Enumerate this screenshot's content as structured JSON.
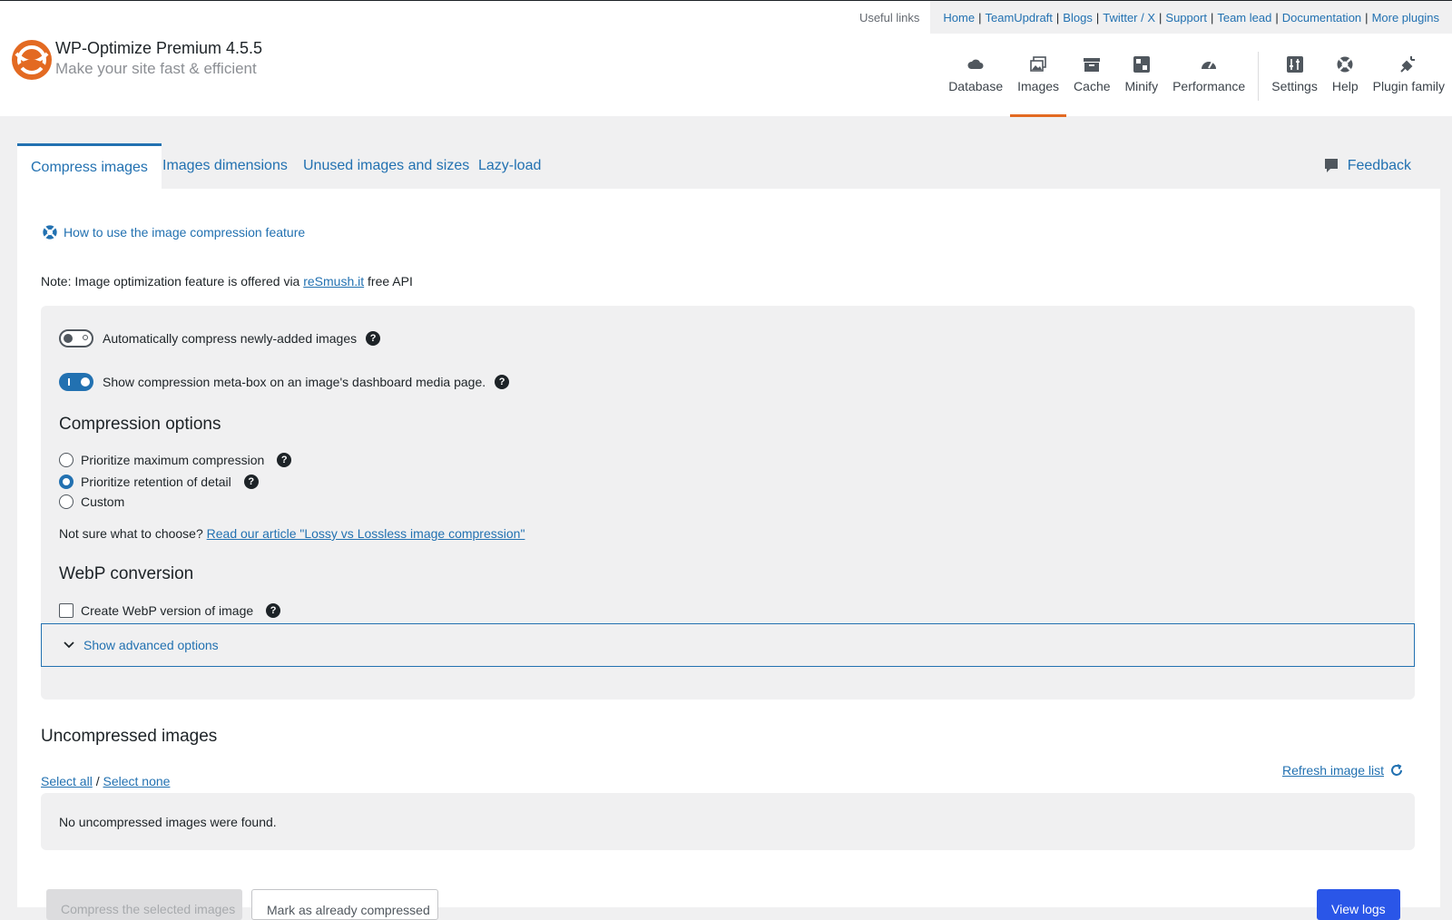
{
  "useful_links": {
    "label": "Useful links",
    "links": [
      "Home",
      "TeamUpdraft",
      "Blogs",
      "Twitter / X",
      "Support",
      "Team lead",
      "Documentation",
      "More plugins"
    ]
  },
  "brand": {
    "title": "WP-Optimize Premium 4.5.5",
    "subtitle": "Make your site fast & efficient"
  },
  "nav": {
    "items": [
      {
        "label": "Database",
        "icon": "cloud-database-icon"
      },
      {
        "label": "Images",
        "icon": "images-icon"
      },
      {
        "label": "Cache",
        "icon": "archive-box-icon"
      },
      {
        "label": "Minify",
        "icon": "minify-grid-icon"
      },
      {
        "label": "Performance",
        "icon": "dashboard-gauge-icon"
      },
      {
        "label": "Settings",
        "icon": "settings-sliders-icon"
      },
      {
        "label": "Help",
        "icon": "lifebuoy-icon"
      },
      {
        "label": "Plugin family",
        "icon": "plug-icon"
      }
    ],
    "active": "Images",
    "accent": "#e36a22"
  },
  "tabs": {
    "items": [
      "Compress images",
      "Images dimensions",
      "Unused images and sizes",
      "Lazy-load"
    ],
    "active": "Compress images",
    "feedback": "Feedback"
  },
  "content": {
    "howto": "How to use the image compression feature",
    "note_prefix": "Note: Image optimization feature is offered via ",
    "note_link": "reSmush.it",
    "note_suffix": " free API",
    "toggle_auto": "Automatically compress newly-added images",
    "toggle_meta": "Show compression meta-box on an image's dashboard media page.",
    "compression_heading": "Compression options",
    "radio_max": "Prioritize maximum compression",
    "radio_retention": "Prioritize retention of detail",
    "radio_custom": "Custom",
    "notsure_prefix": "Not sure what to choose? ",
    "notsure_link": "Read our article \"Lossy vs Lossless image compression\"",
    "webp_heading": "WebP conversion",
    "webp_checkbox": "Create WebP version of image",
    "advanced": "Show advanced options",
    "uncompressed_heading": "Uncompressed images",
    "select_all": "Select all",
    "select_sep": " / ",
    "select_none": "Select none",
    "refresh": "Refresh image list",
    "no_images": "No uncompressed images were found.",
    "btn_compress": "Compress the selected images",
    "btn_mark": "Mark as already compressed",
    "btn_view": "View logs"
  },
  "colors": {
    "link": "#2271b1",
    "primary_button": "#2a56e8"
  }
}
